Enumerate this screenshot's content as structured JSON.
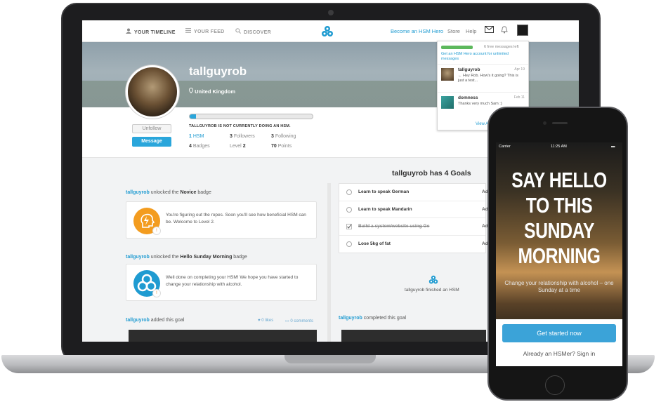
{
  "nav": {
    "timeline": "YOUR TIMELINE",
    "feed": "YOUR FEED",
    "discover": "DISCOVER",
    "hero_link": "Become an HSM Hero",
    "store": "Store",
    "help": "Help"
  },
  "profile": {
    "username": "tallguyrob",
    "location": "United Kingdom",
    "hsm_status": "TALLGUYROB IS NOT CURRENTLY DOING AN HSM.",
    "progress_percent": 5,
    "unfollow": "Unfollow",
    "message": "Message",
    "stats": {
      "hsm_num": "1",
      "hsm_label": "HSM",
      "followers_num": "3",
      "followers_label": "Followers",
      "following_num": "3",
      "following_label": "Following",
      "badges_num": "4",
      "badges_label": "Badges",
      "level_label": "Level",
      "level_num": "2",
      "points_num": "70",
      "points_label": "Points"
    }
  },
  "goals": {
    "title": "tallguyrob has 4 Goals",
    "items": [
      {
        "label": "Learn to speak German",
        "done": false,
        "action": "Add"
      },
      {
        "label": "Learn to speak Mandarin",
        "done": false,
        "action": "Add"
      },
      {
        "label": "Build a system/website using Go",
        "done": true,
        "action": "Add"
      },
      {
        "label": "Lose 5kg of fat",
        "done": false,
        "action": "Add"
      }
    ],
    "finished_text": "tallguyrob finished an HSM",
    "completed_user": "tallguyrob",
    "completed_text": "completed this goal"
  },
  "feed": {
    "items": [
      {
        "user": "tallguyrob",
        "pre": "unlocked the",
        "badge": "Novice",
        "post": "badge",
        "text": "You're figuring out the ropes. Soon you'll see how beneficial HSM can be. Welcome to Level 2."
      },
      {
        "user": "tallguyrob",
        "pre": "unlocked the",
        "badge": "Hello Sunday Morning",
        "post": "badge",
        "text": "Well done on completing your HSM! We hope you have started to change your relationship with alcohol."
      }
    ],
    "goal_user": "tallguyrob",
    "goal_text": "added this goal",
    "likes": "0 likes",
    "comments": "0 comments"
  },
  "dropdown": {
    "free_left": "6 free messages left",
    "free_fraction": 1.0,
    "upgrade": "Get an HSM Hero account for unlimited messages",
    "messages": [
      {
        "name": "tallguyrob",
        "date": "Apr 19",
        "text": "← Hey Rob. How's it going? This is just a test..."
      },
      {
        "name": "domness",
        "date": "Feb 11",
        "text": "Thanks very much Sam :)"
      }
    ],
    "view_all": "View All"
  },
  "phone": {
    "carrier": "Carrier",
    "time": "11:25 AM",
    "headline_lines": [
      "SAY HELLO",
      "TO THIS",
      "SUNDAY",
      "MORNING"
    ],
    "subtitle": "Change your relationship with alcohol – one Sunday at a time",
    "cta": "Get started now",
    "signin": "Already an HSMer? Sign in"
  },
  "colors": {
    "accent": "#1f9bd1",
    "badge_orange": "#f39c1f",
    "cta_blue": "#3ba3d8"
  },
  "icons": [
    "user-icon",
    "list-icon",
    "search-icon",
    "hsm-logo-icon",
    "mail-icon",
    "bell-icon",
    "location-pin-icon",
    "lightning-head-icon",
    "check-icon",
    "heart-icon",
    "comment-icon"
  ]
}
